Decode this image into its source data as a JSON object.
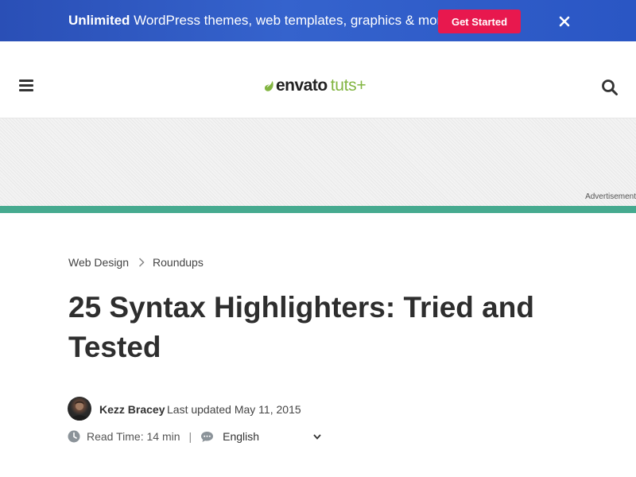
{
  "promo": {
    "highlight": "Unlimited",
    "text": " WordPress themes, web templates, graphics & more!",
    "cta_label": "Get Started"
  },
  "header": {
    "logo_primary": "envato",
    "logo_secondary": "tuts+"
  },
  "ad": {
    "label": "Advertisement"
  },
  "breadcrumb": {
    "items": [
      "Web Design",
      "Roundups"
    ]
  },
  "article": {
    "title": "25 Syntax Highlighters: Tried and Tested",
    "author": "Kezz Bracey",
    "updated": "Last updated May 11, 2015",
    "read_time": "Read Time: 14 min",
    "divider": "|",
    "language": "English"
  },
  "colors": {
    "promo_bg": "#2f5dc6",
    "cta": "#e8184e",
    "accent_bar": "#46aa8f",
    "logo_green": "#82b541"
  },
  "icons": [
    "close-icon",
    "menu-icon",
    "envato-leaf-icon",
    "search-icon",
    "chevron-right-icon",
    "clock-icon",
    "chat-bubble-icon",
    "chevron-down-icon"
  ]
}
